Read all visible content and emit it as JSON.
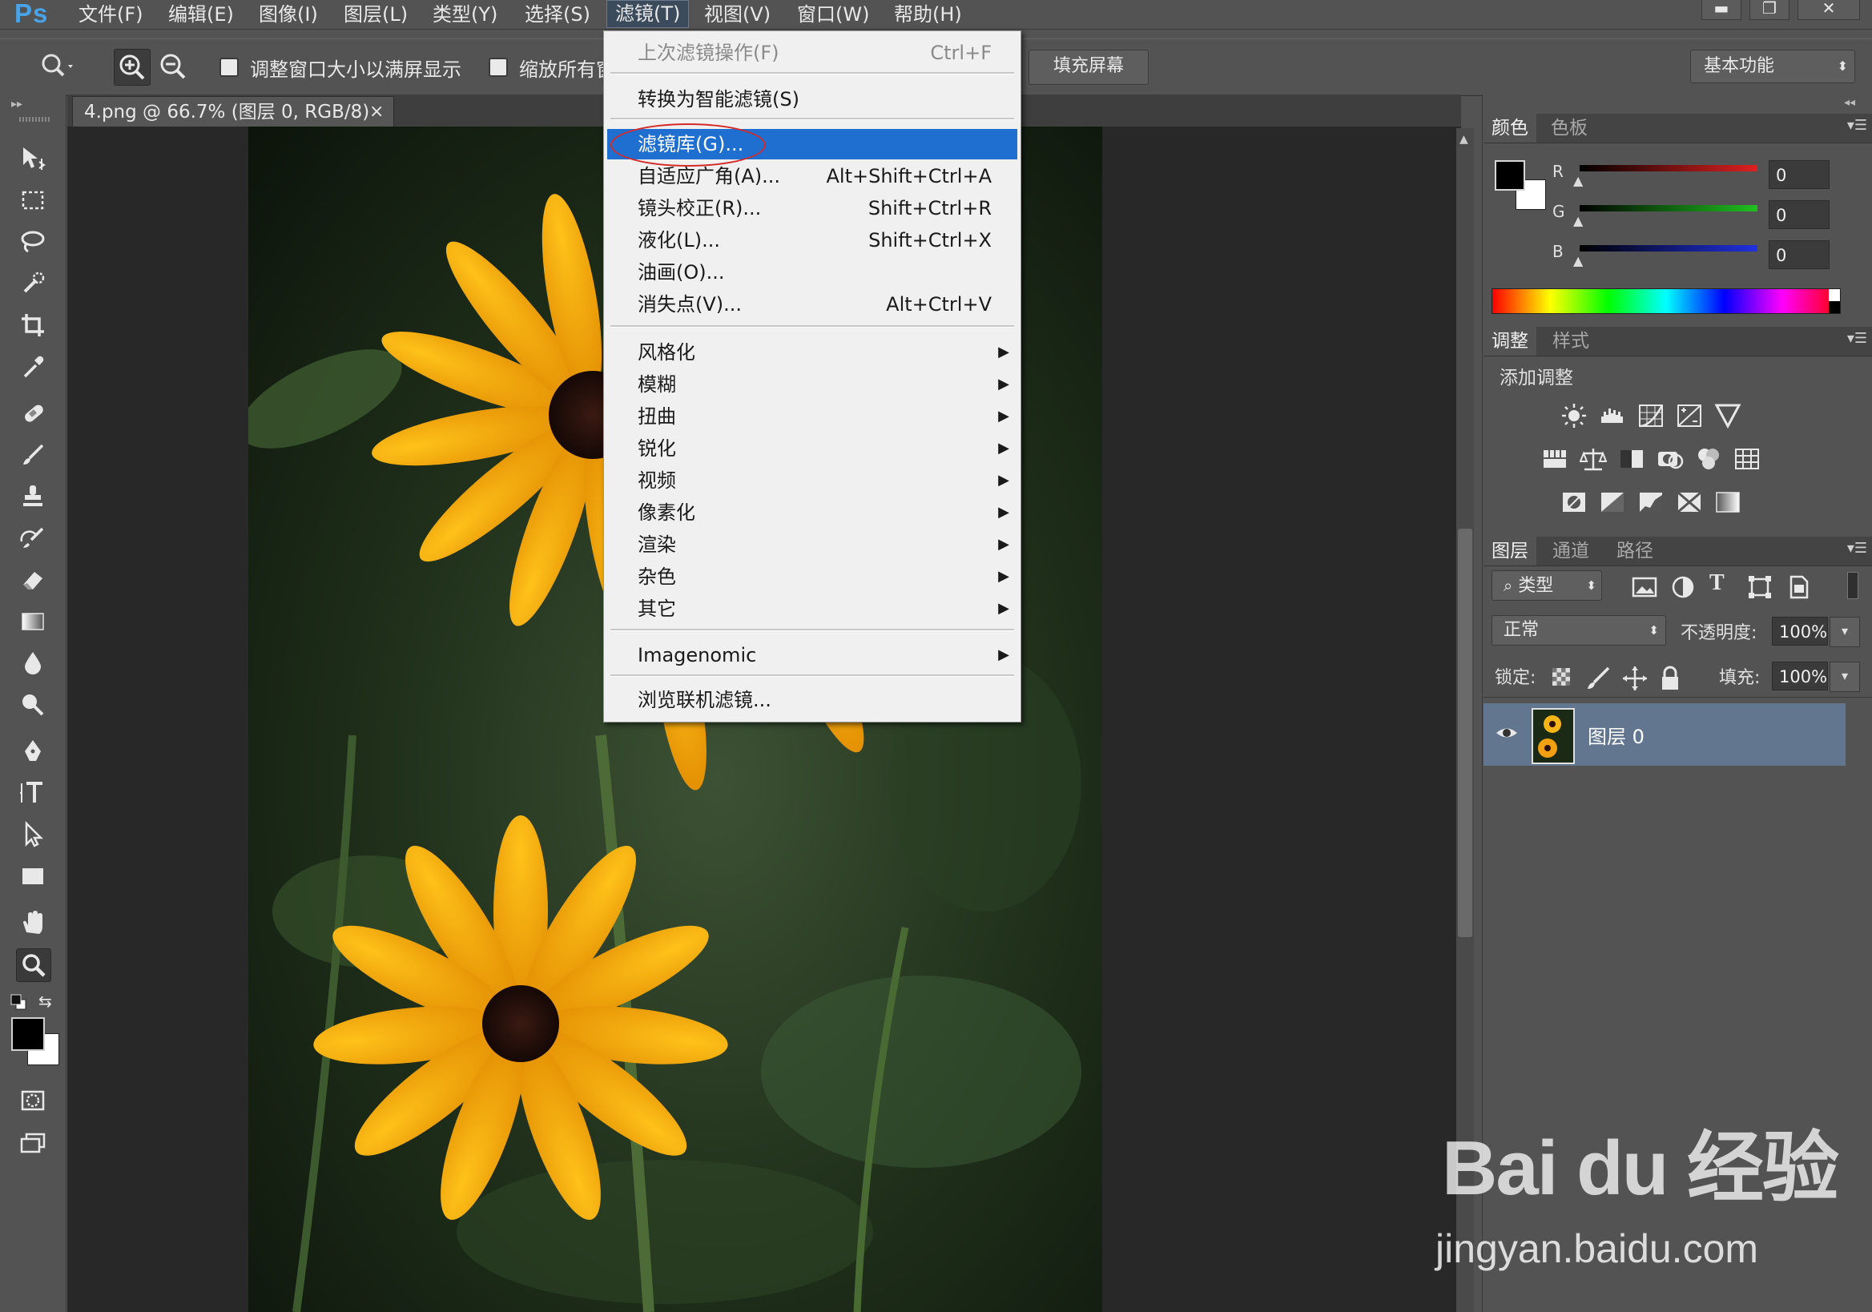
{
  "app": {
    "logo": "Ps"
  },
  "menubar": {
    "items": [
      "文件(F)",
      "编辑(E)",
      "图像(I)",
      "图层(L)",
      "类型(Y)",
      "选择(S)",
      "滤镜(T)",
      "视图(V)",
      "窗口(W)",
      "帮助(H)"
    ],
    "active_index": 6
  },
  "window_controls": {
    "minimize": "▬",
    "restore": "❐",
    "close": "✕"
  },
  "options_bar": {
    "resize_windows_label": "调整窗口大小以满屏显示",
    "zoom_all_label": "缩放所有窗",
    "fill_screen_button": "填充屏幕",
    "workspace": "基本功能"
  },
  "document": {
    "tab_title": "4.png @ 66.7% (图层 0, RGB/8)",
    "tab_close": "×"
  },
  "filter_menu": {
    "last_filter": {
      "label": "上次滤镜操作(F)",
      "shortcut": "Ctrl+F",
      "disabled": true
    },
    "convert_smart": {
      "label": "转换为智能滤镜(S)"
    },
    "gallery": {
      "label": "滤镜库(G)...",
      "highlighted": true
    },
    "specials": [
      {
        "label": "自适应广角(A)...",
        "shortcut": "Alt+Shift+Ctrl+A"
      },
      {
        "label": "镜头校正(R)...",
        "shortcut": "Shift+Ctrl+R"
      },
      {
        "label": "液化(L)...",
        "shortcut": "Shift+Ctrl+X"
      },
      {
        "label": "油画(O)...",
        "shortcut": ""
      },
      {
        "label": "消失点(V)...",
        "shortcut": "Alt+Ctrl+V"
      }
    ],
    "submenus": [
      "风格化",
      "模糊",
      "扭曲",
      "锐化",
      "视频",
      "像素化",
      "渲染",
      "杂色",
      "其它"
    ],
    "plugin": "Imagenomic",
    "browse_online": "浏览联机滤镜..."
  },
  "color_panel": {
    "tabs": [
      "颜色",
      "色板"
    ],
    "channels": [
      {
        "name": "R",
        "value": "0",
        "color": "#e02020"
      },
      {
        "name": "G",
        "value": "0",
        "color": "#20c020"
      },
      {
        "name": "B",
        "value": "0",
        "color": "#2030e0"
      }
    ]
  },
  "adjustments_panel": {
    "tabs": [
      "调整",
      "样式"
    ],
    "add_label": "添加调整"
  },
  "layers_panel": {
    "tabs": [
      "图层",
      "通道",
      "路径"
    ],
    "filter_kind": "类型",
    "blend_mode": "正常",
    "opacity_label": "不透明度:",
    "opacity": "100%",
    "lock_label": "锁定:",
    "fill_label": "填充:",
    "fill": "100%",
    "layers": [
      {
        "name": "图层 0",
        "visible": true
      }
    ]
  },
  "watermark": {
    "brand": "Bai du 经验",
    "url": "jingyan.baidu.com"
  },
  "colors": {
    "highlight": "#1f6fd0",
    "annotation_circle": "#d42a2a",
    "panel_bg": "#535353"
  }
}
